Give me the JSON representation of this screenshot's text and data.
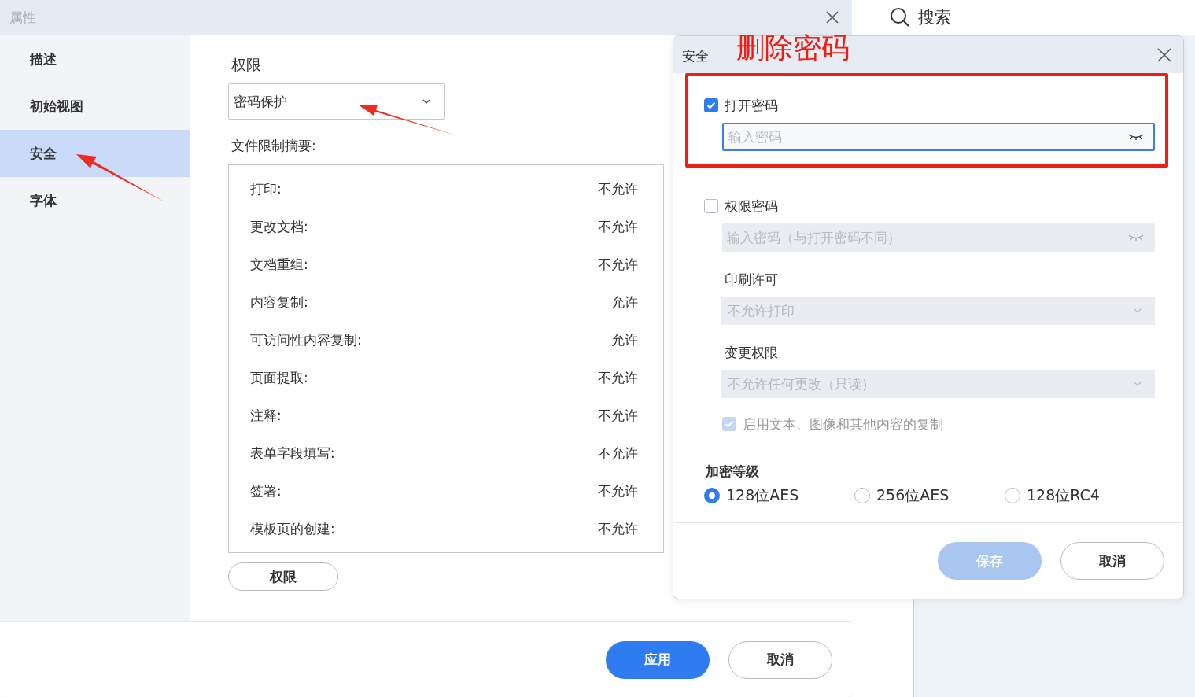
{
  "properties_dialog": {
    "title": "属性",
    "sidebar": [
      {
        "label": "描述",
        "selected": false
      },
      {
        "label": "初始视图",
        "selected": false
      },
      {
        "label": "安全",
        "selected": true
      },
      {
        "label": "字体",
        "selected": false
      }
    ],
    "section_title": "权限",
    "security_method": "密码保护",
    "summary_label": "文件限制摘要:",
    "restrictions": [
      {
        "name": "打印:",
        "value": "不允许"
      },
      {
        "name": "更改文档:",
        "value": "不允许"
      },
      {
        "name": "文档重组:",
        "value": "不允许"
      },
      {
        "name": "内容复制:",
        "value": "允许"
      },
      {
        "name": "可访问性内容复制:",
        "value": "允许"
      },
      {
        "name": "页面提取:",
        "value": "不允许"
      },
      {
        "name": "注释:",
        "value": "不允许"
      },
      {
        "name": "表单字段填写:",
        "value": "不允许"
      },
      {
        "name": "签署:",
        "value": "不允许"
      },
      {
        "name": "模板页的创建:",
        "value": "不允许"
      }
    ],
    "permissions_button": "权限",
    "buttons": [
      {
        "label": "应用",
        "kind": "primary"
      },
      {
        "label": "取消",
        "kind": "secondary"
      }
    ]
  },
  "search": {
    "label": "搜索"
  },
  "security_dialog": {
    "title": "安全",
    "open_password": {
      "label": "打开密码",
      "checked": true,
      "placeholder": "输入密码"
    },
    "permission_password": {
      "label": "权限密码",
      "checked": false,
      "placeholder": "输入密码（与打开密码不同）"
    },
    "print_permission": {
      "label": "印刷许可",
      "value": "不允许打印",
      "disabled": true
    },
    "change_permission": {
      "label": "变更权限",
      "value": "不允许任何更改（只读）",
      "disabled": true
    },
    "copy": {
      "label": "启用文本、图像和其他内容的复制",
      "checked": true,
      "disabled": true
    },
    "encryption": {
      "title": "加密等级",
      "options": [
        {
          "label": "128位AES",
          "selected": true
        },
        {
          "label": "256位AES",
          "selected": false
        },
        {
          "label": "128位RC4",
          "selected": false
        }
      ]
    },
    "buttons": [
      {
        "label": "保存",
        "kind": "primary",
        "disabled": true
      },
      {
        "label": "取消",
        "kind": "secondary"
      }
    ]
  },
  "annotation": {
    "text": "删除密码"
  }
}
